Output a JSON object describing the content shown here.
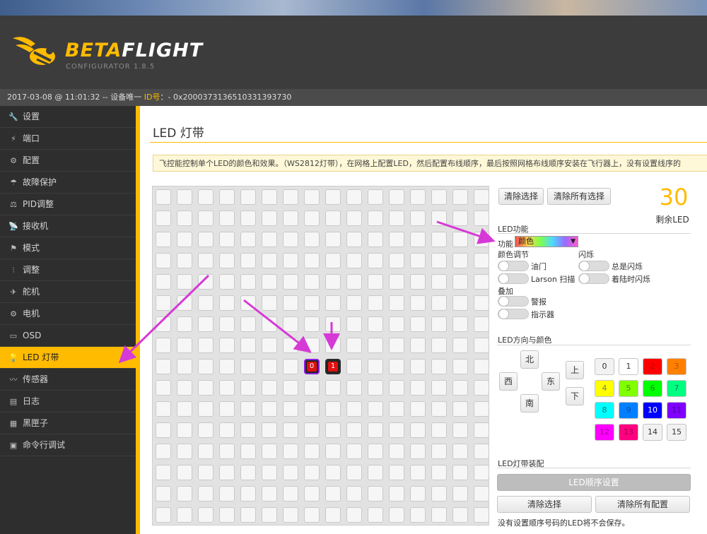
{
  "app": {
    "brand_part1": "BETA",
    "brand_part2": "FLIGHT",
    "brand_subtitle": "CONFIGURATOR  1.8.5",
    "status_prefix": "2017-03-08 @ 11:01:32 -- 设备唯一 ",
    "status_id_label": "ID号",
    "status_id_value": "：- 0x2000373136510331393730"
  },
  "sidebar": {
    "items": [
      {
        "icon": "wrench-icon",
        "glyph": "🔧",
        "label": "设置"
      },
      {
        "icon": "plug-icon",
        "glyph": "⚡",
        "label": "端口"
      },
      {
        "icon": "gear-icon",
        "glyph": "⚙",
        "label": "配置"
      },
      {
        "icon": "parachute-icon",
        "glyph": "☂",
        "label": "故障保护"
      },
      {
        "icon": "pid-icon",
        "glyph": "⚖",
        "label": "PID调整"
      },
      {
        "icon": "receiver-icon",
        "glyph": "📡",
        "label": "接收机"
      },
      {
        "icon": "modes-icon",
        "glyph": "⚑",
        "label": "模式"
      },
      {
        "icon": "sliders-icon",
        "glyph": "⫶",
        "label": "调整"
      },
      {
        "icon": "servo-icon",
        "glyph": "✈",
        "label": "舵机"
      },
      {
        "icon": "motor-icon",
        "glyph": "⚙",
        "label": "电机"
      },
      {
        "icon": "osd-icon",
        "glyph": "▭",
        "label": "OSD"
      },
      {
        "icon": "led-bulb-icon",
        "glyph": "💡",
        "label": "LED 灯带"
      },
      {
        "icon": "sensor-icon",
        "glyph": "〰",
        "label": "传感器"
      },
      {
        "icon": "log-icon",
        "glyph": "▤",
        "label": "日志"
      },
      {
        "icon": "blackbox-icon",
        "glyph": "▦",
        "label": "黑匣子"
      },
      {
        "icon": "cli-icon",
        "glyph": "▣",
        "label": "命令行调试"
      }
    ],
    "active_index": 11
  },
  "main": {
    "title": "LED 灯带",
    "note": "飞控能控制单个LED的颜色和效果。（WS2812灯带），在网格上配置LED，然后配置布线顺序，最后按照网格布线顺序安装在飞行器上，没有设置线序的",
    "grid": {
      "rows": 16,
      "cols": 16,
      "leds": [
        {
          "row": 8,
          "col": 7,
          "number": "0",
          "color": "#e01010",
          "selected": true
        },
        {
          "row": 8,
          "col": 8,
          "number": "1",
          "color": "#e01010",
          "selected": false
        }
      ]
    },
    "clear_selection_btn": "清除选择",
    "clear_all_selection_btn": "清除所有选择",
    "remaining_count": "30",
    "remaining_label": "剩余LED",
    "led_function_title": "LED功能",
    "function_label": "功能",
    "function_value": "颜色",
    "color_adjust_label": "颜色调节",
    "flash_label": "闪烁",
    "throttle_label": "油门",
    "larson_label": "Larson 扫描",
    "always_flash_label": "总是闪烁",
    "follow_flash_label": "着陆时闪烁",
    "overlay_label": "叠加",
    "warning_label": "警报",
    "indicator_label": "指示器",
    "direction_color_title": "LED方向与颜色",
    "directions": {
      "north": "北",
      "west": "西",
      "east": "东",
      "south": "南",
      "up": "上",
      "down": "下"
    },
    "colors": [
      {
        "label": "0",
        "bg": "#f2f2f2",
        "fg": "#333"
      },
      {
        "label": "1",
        "bg": "#ffffff",
        "fg": "#333"
      },
      {
        "label": "2",
        "bg": "#ff0000",
        "fg": "#b00"
      },
      {
        "label": "3",
        "bg": "#ff8000",
        "fg": "#c05000"
      },
      {
        "label": "4",
        "bg": "#ffff00",
        "fg": "#777"
      },
      {
        "label": "5",
        "bg": "#80ff00",
        "fg": "#4a8a00"
      },
      {
        "label": "6",
        "bg": "#00ff00",
        "fg": "#0a8a0a"
      },
      {
        "label": "7",
        "bg": "#00ff80",
        "fg": "#0a8a50"
      },
      {
        "label": "8",
        "bg": "#00ffff",
        "fg": "#0a7a7a"
      },
      {
        "label": "9",
        "bg": "#0080ff",
        "fg": "#0a4aa0"
      },
      {
        "label": "10",
        "bg": "#0000ff",
        "fg": "#ffffff"
      },
      {
        "label": "11",
        "bg": "#8000ff",
        "fg": "#4a0090"
      },
      {
        "label": "12",
        "bg": "#ff00ff",
        "fg": "#a000a0"
      },
      {
        "label": "13",
        "bg": "#ff0080",
        "fg": "#a00050"
      },
      {
        "label": "14",
        "bg": "#f2f2f2",
        "fg": "#333"
      },
      {
        "label": "15",
        "bg": "#f2f2f2",
        "fg": "#333"
      }
    ],
    "strip_assembly_title": "LED灯带装配",
    "wire_order_btn": "LED顺序设置",
    "clear_selection2_btn": "清除选择",
    "clear_all_config_btn": "清除所有配置",
    "unsaved_note": "没有设置顺序号码的LED将不会保存。"
  },
  "colors": {
    "accent": "#ffbb00",
    "arrow": "#d63ad6",
    "led_red": "#e01010"
  }
}
